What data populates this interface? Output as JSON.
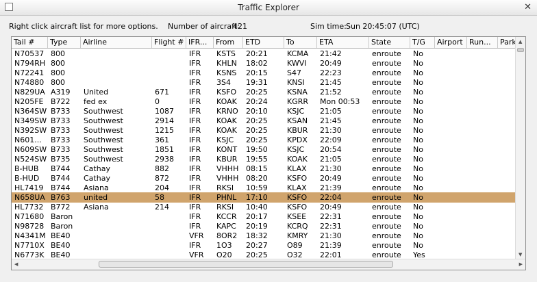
{
  "window": {
    "title": "Traffic Explorer",
    "close_glyph": "✕"
  },
  "info": {
    "hint": "Right click aircraft list for more options.",
    "count_label": "Number of aircraft:",
    "count_value": "421",
    "sim_label": "Sim time:",
    "sim_value": "Sun 20:45:07 (UTC)"
  },
  "table": {
    "columns": [
      "Tail #",
      "Type",
      "Airline",
      "Flight #",
      "IFR...",
      "From",
      "ETD",
      "To",
      "ETA",
      "State",
      "T/G",
      "Airport",
      "Run...",
      "Park..."
    ],
    "selected_row": 15,
    "selection_color": "#d0a46c",
    "rows": [
      [
        "N70537",
        "800",
        "",
        "",
        "IFR",
        "KSTS",
        "20:21",
        "KCMA",
        "21:42",
        "enroute",
        "No"
      ],
      [
        "N794RH",
        "800",
        "",
        "",
        "IFR",
        "KHLN",
        "18:02",
        "KWVI",
        "20:49",
        "enroute",
        "No"
      ],
      [
        "N72241",
        "800",
        "",
        "",
        "IFR",
        "KSNS",
        "20:15",
        "S47",
        "22:23",
        "enroute",
        "No"
      ],
      [
        "N74880",
        "800",
        "",
        "",
        "IFR",
        "3S4",
        "19:31",
        "KNSI",
        "21:45",
        "enroute",
        "No"
      ],
      [
        "N829UA",
        "A319",
        "United",
        "671",
        "IFR",
        "KSFO",
        "20:25",
        "KSNA",
        "21:52",
        "enroute",
        "No"
      ],
      [
        "N205FE",
        "B722",
        "fed ex",
        "0",
        "IFR",
        "KOAK",
        "20:24",
        "KGRR",
        "Mon 00:53",
        "enroute",
        "No"
      ],
      [
        "N364SW",
        "B733",
        "Southwest",
        "1087",
        "IFR",
        "KRNO",
        "20:10",
        "KSJC",
        "21:05",
        "enroute",
        "No"
      ],
      [
        "N349SW",
        "B733",
        "Southwest",
        "2914",
        "IFR",
        "KOAK",
        "20:25",
        "KSAN",
        "21:45",
        "enroute",
        "No"
      ],
      [
        "N392SW",
        "B733",
        "Southwest",
        "1215",
        "IFR",
        "KOAK",
        "20:25",
        "KBUR",
        "21:30",
        "enroute",
        "No"
      ],
      [
        "N601...",
        "B733",
        "Southwest",
        "361",
        "IFR",
        "KSJC",
        "20:25",
        "KPDX",
        "22:09",
        "enroute",
        "No"
      ],
      [
        "N609SW",
        "B733",
        "Southwest",
        "1851",
        "IFR",
        "KONT",
        "19:50",
        "KSJC",
        "20:54",
        "enroute",
        "No"
      ],
      [
        "N524SW",
        "B735",
        "Southwest",
        "2938",
        "IFR",
        "KBUR",
        "19:55",
        "KOAK",
        "21:05",
        "enroute",
        "No"
      ],
      [
        "B-HUB",
        "B744",
        "Cathay",
        "882",
        "IFR",
        "VHHH",
        "08:15",
        "KLAX",
        "21:30",
        "enroute",
        "No"
      ],
      [
        "B-HUD",
        "B744",
        "Cathay",
        "872",
        "IFR",
        "VHHH",
        "08:20",
        "KSFO",
        "20:49",
        "enroute",
        "No"
      ],
      [
        "HL7419",
        "B744",
        "Asiana",
        "204",
        "IFR",
        "RKSI",
        "10:59",
        "KLAX",
        "21:39",
        "enroute",
        "No"
      ],
      [
        "N658UA",
        "B763",
        "united",
        "58",
        "IFR",
        "PHNL",
        "17:10",
        "KSFO",
        "22:04",
        "enroute",
        "No"
      ],
      [
        "HL7732",
        "B772",
        "Asiana",
        "214",
        "IFR",
        "RKSI",
        "10:40",
        "KSFO",
        "20:49",
        "enroute",
        "No"
      ],
      [
        "N71680",
        "Baron",
        "",
        "",
        "IFR",
        "KCCR",
        "20:17",
        "KSEE",
        "22:31",
        "enroute",
        "No"
      ],
      [
        "N98728",
        "Baron",
        "",
        "",
        "IFR",
        "KAPC",
        "20:19",
        "KCRQ",
        "22:31",
        "enroute",
        "No"
      ],
      [
        "N4341M",
        "BE40",
        "",
        "",
        "VFR",
        "8OR2",
        "18:32",
        "KMRY",
        "21:30",
        "enroute",
        "No"
      ],
      [
        "N7710X",
        "BE40",
        "",
        "",
        "IFR",
        "1O3",
        "20:27",
        "O89",
        "21:39",
        "enroute",
        "No"
      ],
      [
        "N6773K",
        "BE40",
        "",
        "",
        "VFR",
        "O20",
        "20:25",
        "O32",
        "22:01",
        "enroute",
        "Yes"
      ]
    ]
  }
}
